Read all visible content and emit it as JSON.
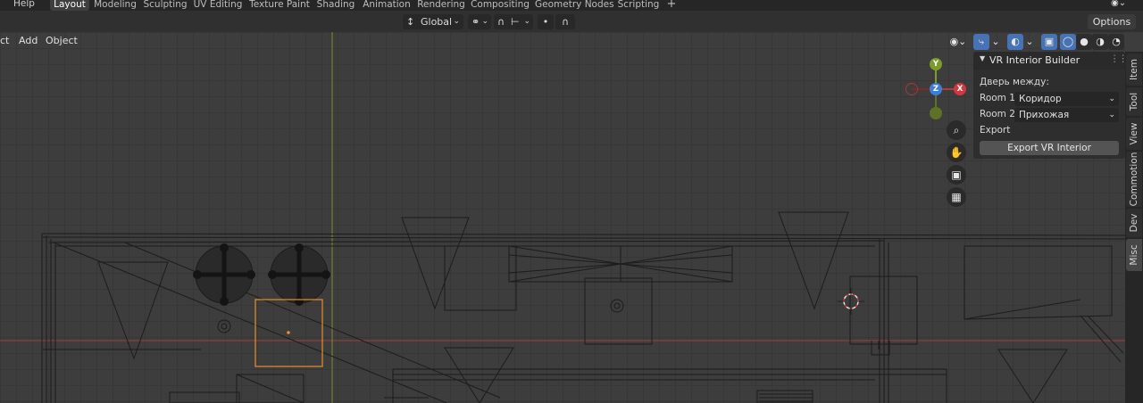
{
  "topbar": {
    "menu_help": "Help",
    "tabs": [
      {
        "label": "Layout",
        "active": true
      },
      {
        "label": "Modeling"
      },
      {
        "label": "Sculpting"
      },
      {
        "label": "UV Editing"
      },
      {
        "label": "Texture Paint"
      },
      {
        "label": "Shading"
      },
      {
        "label": "Animation"
      },
      {
        "label": "Rendering"
      },
      {
        "label": "Compositing"
      },
      {
        "label": "Geometry Nodes"
      },
      {
        "label": "Scripting"
      }
    ],
    "add_tab": "+"
  },
  "header": {
    "transform_orientation": "Global",
    "options_label": "Options"
  },
  "viewport_menu": {
    "items": [
      "ct",
      "Add",
      "Object"
    ]
  },
  "gizmo": {
    "y": "Y",
    "z": "Z",
    "x": "X"
  },
  "panel": {
    "title": "VR Interior Builder",
    "door_between_label": "Дверь между:",
    "room1_label": "Room 1:",
    "room1_value": "Коридор",
    "room2_label": "Room 2:",
    "room2_value": "Прихожая",
    "export_label": "Export",
    "export_button": "Export VR Interior"
  },
  "sidebar_tabs": [
    {
      "label": "Item"
    },
    {
      "label": "Tool"
    },
    {
      "label": "View"
    },
    {
      "label": "Commotion"
    },
    {
      "label": "Dev"
    },
    {
      "label": "Misc",
      "active": true
    }
  ],
  "colors": {
    "selection_orange": "#e8902b",
    "x_axis_red": "#b53a3a",
    "y_axis_green": "#7e9a2a",
    "accent_blue": "#4772b3"
  }
}
